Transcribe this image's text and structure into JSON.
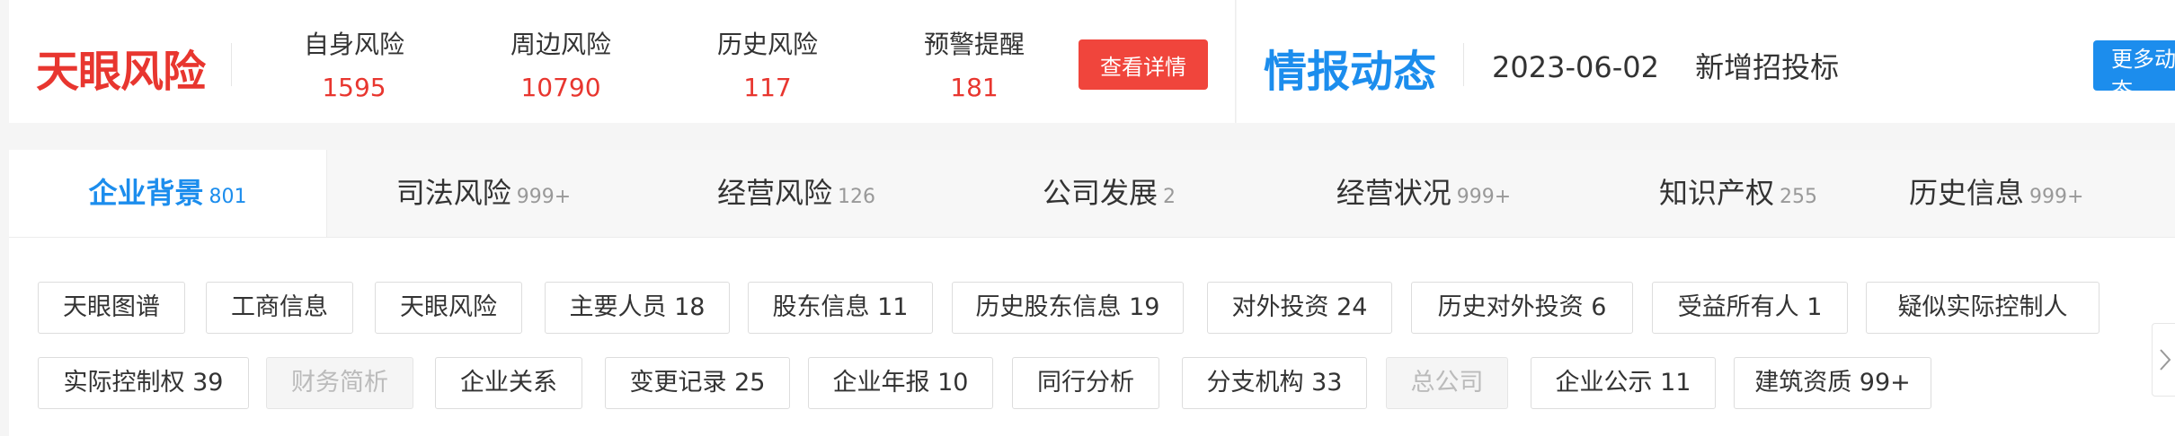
{
  "risk": {
    "brand": "天眼风险",
    "stats": [
      {
        "label": "自身风险",
        "value": "1595"
      },
      {
        "label": "周边风险",
        "value": "10790"
      },
      {
        "label": "历史风险",
        "value": "117"
      },
      {
        "label": "预警提醒",
        "value": "181"
      }
    ],
    "detail_button": "查看详情"
  },
  "intel": {
    "brand": "情报动态",
    "date": "2023-06-02",
    "text": "新增招投标",
    "more_button": "更多动态"
  },
  "tabs": [
    {
      "label": "企业背景",
      "count": "801"
    },
    {
      "label": "司法风险",
      "count": "999+"
    },
    {
      "label": "经营风险",
      "count": "126"
    },
    {
      "label": "公司发展",
      "count": "2"
    },
    {
      "label": "经营状况",
      "count": "999+"
    },
    {
      "label": "知识产权",
      "count": "255"
    },
    {
      "label": "历史信息",
      "count": "999+"
    }
  ],
  "tags": [
    {
      "label": "天眼图谱"
    },
    {
      "label": "工商信息"
    },
    {
      "label": "天眼风险"
    },
    {
      "label": "主要人员 18"
    },
    {
      "label": "股东信息 11"
    },
    {
      "label": "历史股东信息 19"
    },
    {
      "label": "对外投资 24"
    },
    {
      "label": "历史对外投资 6"
    },
    {
      "label": "受益所有人 1"
    },
    {
      "label": "疑似实际控制人"
    },
    {
      "label": "实际控制权 39"
    },
    {
      "label": "财务简析"
    },
    {
      "label": "企业关系"
    },
    {
      "label": "变更记录 25"
    },
    {
      "label": "企业年报 10"
    },
    {
      "label": "同行分析"
    },
    {
      "label": "分支机构 33"
    },
    {
      "label": "总公司"
    },
    {
      "label": "企业公示 11"
    },
    {
      "label": "建筑资质 99+"
    }
  ],
  "colors": {
    "risk_red": "#e8362f",
    "brand_blue": "#1c8ded"
  },
  "icons": {
    "side_arrow": "chevron-right-icon"
  }
}
